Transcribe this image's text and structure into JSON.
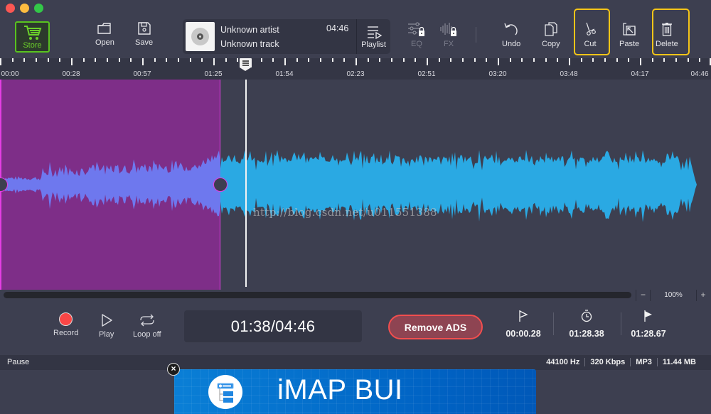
{
  "window": {
    "controls": [
      "close",
      "minimize",
      "zoom"
    ]
  },
  "toolbar": {
    "store_label": "Store",
    "open_label": "Open",
    "save_label": "Save",
    "playlist_label": "Playlist",
    "eq_label": "EQ",
    "fx_label": "FX",
    "undo_label": "Undo",
    "copy_label": "Copy",
    "cut_label": "Cut",
    "paste_label": "Paste",
    "delete_label": "Delete",
    "highlighted": [
      "Cut",
      "Delete"
    ],
    "icons": {
      "store": "shopping-cart-icon",
      "open": "folder-icon",
      "save": "floppy-disk-icon",
      "playlist": "playlist-icon",
      "eq": "equalizer-locked-icon",
      "fx": "fx-locked-icon",
      "undo": "undo-icon",
      "copy": "copy-icon",
      "cut": "scissors-icon",
      "paste": "paste-icon",
      "delete": "trash-icon"
    }
  },
  "track": {
    "artist": "Unknown artist",
    "title": "Unknown track",
    "duration": "04:46"
  },
  "timeline": {
    "labels": [
      "00:00",
      "00:28",
      "00:57",
      "01:25",
      "01:54",
      "02:23",
      "02:51",
      "03:20",
      "03:48",
      "04:17",
      "04:46"
    ],
    "playhead_seconds": 98,
    "total_seconds": 286,
    "selection": {
      "start": "00:00.28",
      "end": "01:28.67"
    }
  },
  "watermark": "http://blog.csdn.net/u011551388",
  "zoom": {
    "minus": "−",
    "value": "100%",
    "plus": "+"
  },
  "transport": {
    "record_label": "Record",
    "play_label": "Play",
    "loop_label": "Loop off",
    "time_display": "01:38/04:46",
    "remove_ads_label": "Remove ADS",
    "markers": [
      {
        "icon": "start-flag-icon",
        "value": "00:00.28"
      },
      {
        "icon": "stopwatch-icon",
        "value": "01:28.38"
      },
      {
        "icon": "end-flag-icon",
        "value": "01:28.67"
      }
    ]
  },
  "status": {
    "state": "Pause",
    "sample_rate": "44100 Hz",
    "bitrate": "320 Kbps",
    "format": "MP3",
    "size": "11.44 MB"
  },
  "ad": {
    "text": "iMAP BUI",
    "close": "×"
  },
  "colors": {
    "background": "#3d3f50",
    "selection": "#7e2e88",
    "selection_border": "#e43ee4",
    "wave_selected": "#6e78ee",
    "wave": "#2aa9e3",
    "highlight": "#f5c518",
    "store": "#59c31f",
    "record": "#fa4646"
  }
}
